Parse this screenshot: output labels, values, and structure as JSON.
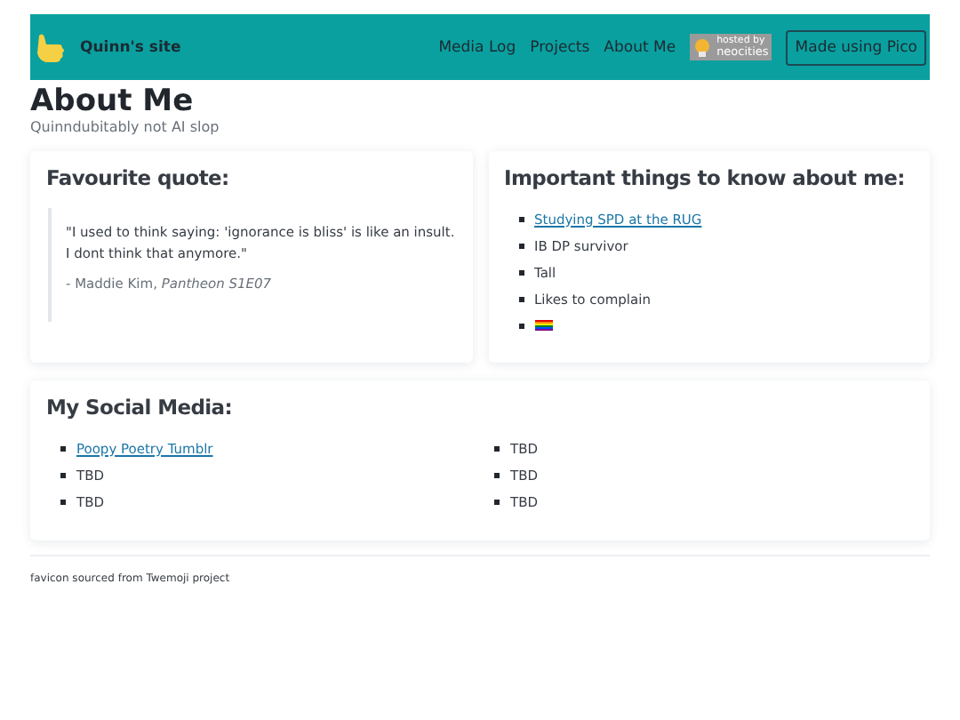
{
  "nav": {
    "site_name": "Quinn's site",
    "links": [
      "Media Log",
      "Projects",
      "About Me"
    ],
    "badge": {
      "small": "hosted by",
      "big": "neocities"
    },
    "button": "Made using Pico"
  },
  "page": {
    "title": "About Me",
    "subtitle": "Quinndubitably not AI slop"
  },
  "quote_card": {
    "title": "Favourite quote:",
    "quote": "\"I used to think saying: 'ignorance is bliss' is like an insult. I dont think that anymore.\"",
    "attribution": "- Maddie Kim, *Pantheon S1E07*"
  },
  "facts_card": {
    "title": "Important things to know about me:",
    "items": [
      {
        "kind": "link",
        "text": "Studying SPD at the RUG"
      },
      {
        "kind": "text",
        "text": "IB DP survivor"
      },
      {
        "kind": "text",
        "text": "Tall"
      },
      {
        "kind": "text",
        "text": "Likes to complain"
      },
      {
        "kind": "flag"
      }
    ]
  },
  "social_card": {
    "title": "My Social Media:",
    "columns": [
      [
        {
          "kind": "link",
          "text": "Poopy Poetry Tumblr"
        },
        {
          "kind": "text",
          "text": "TBD"
        },
        {
          "kind": "text",
          "text": "TBD"
        }
      ],
      [
        {
          "kind": "text",
          "text": "TBD"
        },
        {
          "kind": "text",
          "text": "TBD"
        },
        {
          "kind": "text",
          "text": "TBD"
        }
      ]
    ]
  },
  "footer": "favicon sourced from Twemoji project"
}
